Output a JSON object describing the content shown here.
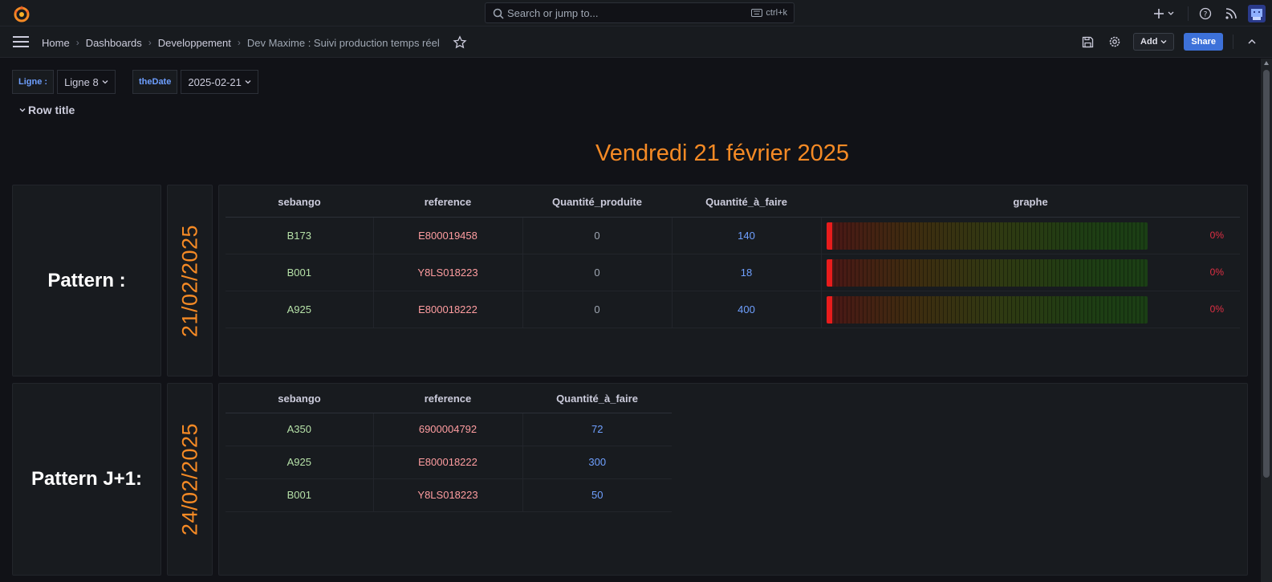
{
  "search": {
    "placeholder": "Search or jump to...",
    "shortcut": "ctrl+k"
  },
  "breadcrumbs": [
    "Home",
    "Dashboards",
    "Developpement",
    "Dev Maxime : Suivi production temps réel"
  ],
  "toolbar": {
    "add_label": "Add",
    "share_label": "Share"
  },
  "variables": [
    {
      "label": "Ligne :",
      "value": "Ligne 8"
    },
    {
      "label": "theDate",
      "value": "2025-02-21"
    }
  ],
  "row_title": "Row title",
  "main_title": "Vendredi 21 février 2025",
  "pattern_today": {
    "title": "Pattern :",
    "date": "21/02/2025",
    "columns": [
      "sebango",
      "reference",
      "Quantité_produite",
      "Quantité_à_faire",
      "graphe"
    ],
    "rows": [
      {
        "sebango": "B173",
        "reference": "E800019458",
        "produite": "0",
        "a_faire": "140",
        "pct": "0%",
        "progress": 0
      },
      {
        "sebango": "B001",
        "reference": "Y8LS018223",
        "produite": "0",
        "a_faire": "18",
        "pct": "0%",
        "progress": 0
      },
      {
        "sebango": "A925",
        "reference": "E800018222",
        "produite": "0",
        "a_faire": "400",
        "pct": "0%",
        "progress": 0
      }
    ]
  },
  "pattern_next": {
    "title": "Pattern J+1:",
    "date": "24/02/2025",
    "columns": [
      "sebango",
      "reference",
      "Quantité_à_faire"
    ],
    "rows": [
      {
        "sebango": "A350",
        "reference": "6900004792",
        "a_faire": "72"
      },
      {
        "sebango": "A925",
        "reference": "E800018222",
        "a_faire": "300"
      },
      {
        "sebango": "B001",
        "reference": "Y8LS018223",
        "a_faire": "50"
      }
    ]
  },
  "colors": {
    "accent": "#f58a25",
    "primary": "#3d71d9",
    "gauge_low": "#e81c1c",
    "pct_text": "#e02f44"
  }
}
